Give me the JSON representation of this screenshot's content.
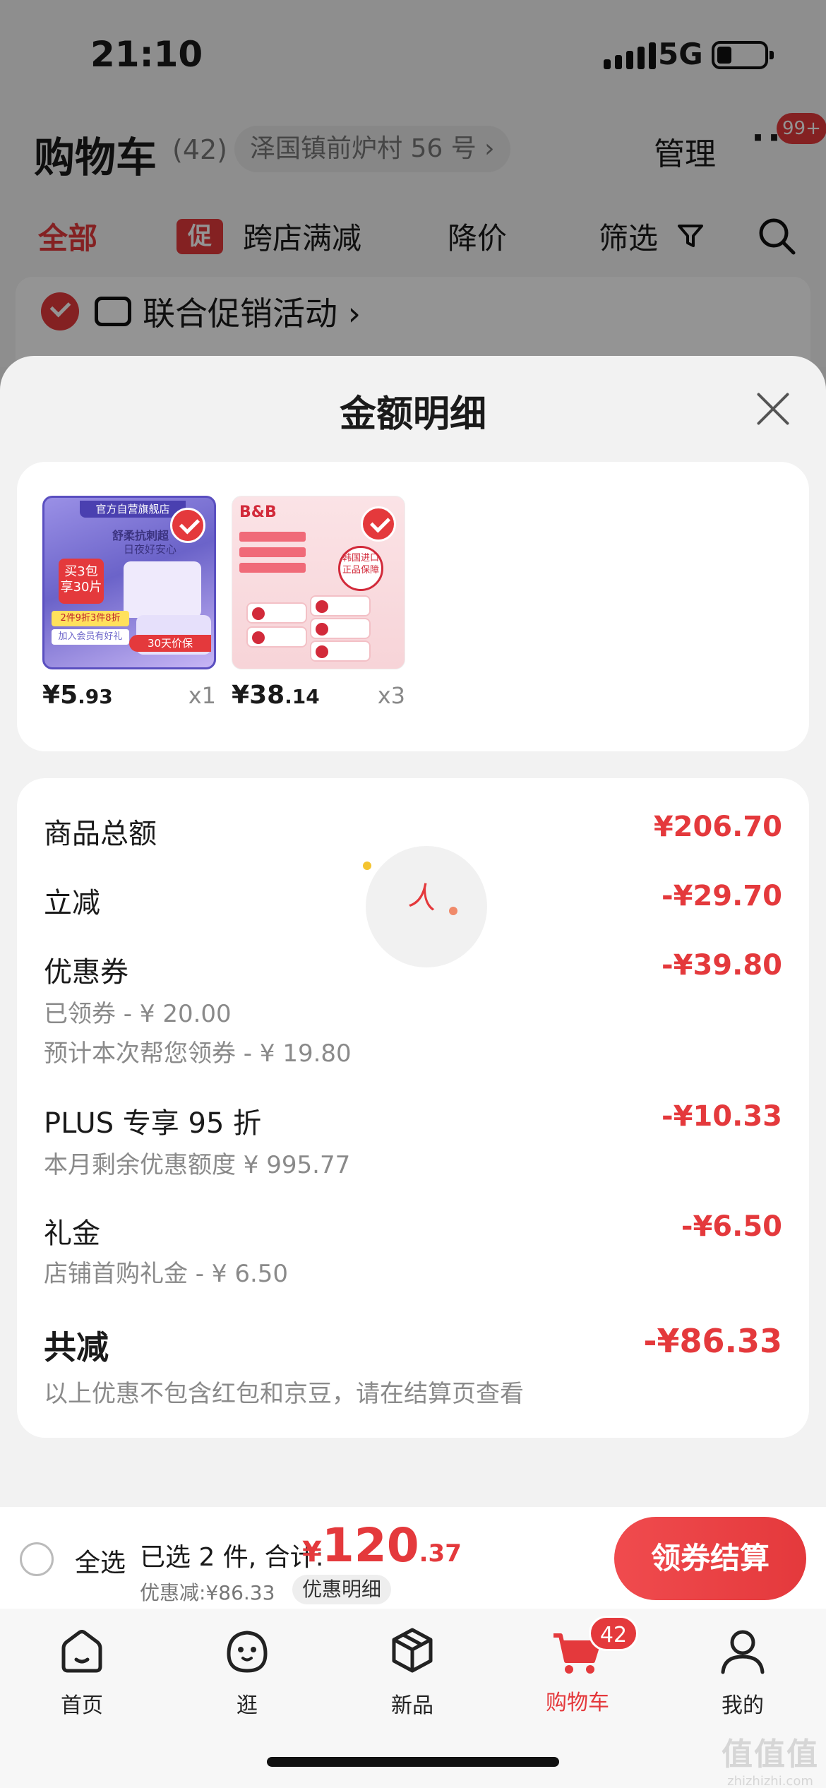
{
  "status_bar": {
    "time": "21:10",
    "network": "5G"
  },
  "cart_header": {
    "title": "购物车",
    "count": "(42)",
    "address": "泽国镇前炉村 56 号 ›",
    "manage": "管理",
    "more": "···",
    "more_badge": "99+"
  },
  "filters": {
    "all": "全部",
    "promo_tag": "促",
    "promo": "跨店满减",
    "price_drop": "降价",
    "filter": "筛选"
  },
  "promo_row": {
    "label": "联合促销活动 ›"
  },
  "sheet": {
    "title": "金额明细",
    "products": [
      {
        "price_symbol": "¥",
        "price_int": "5",
        "price_dec": ".93",
        "qty": "x1",
        "image_text": {
          "store": "官方自营旗舰店",
          "line1": "舒柔抗刺超",
          "line2": "日夜好安心",
          "badge": "买3包 享30片",
          "stripe": "2件9折3件8折",
          "stripe2": "加入会员有好礼",
          "bottom": "30天价保"
        }
      },
      {
        "price_symbol": "¥",
        "price_int": "38",
        "price_dec": ".14",
        "qty": "x3",
        "image_text": {
          "logo": "B&B",
          "seal": "韩国进口 正品保障"
        }
      }
    ],
    "breakdown": {
      "goods_total": {
        "label": "商品总额",
        "value": "¥206.70"
      },
      "instant_off": {
        "label": "立减",
        "value": "-¥29.70"
      },
      "coupon": {
        "label": "优惠券",
        "value": "-¥39.80",
        "sub1": "已领券 - ¥ 20.00",
        "sub2": "预计本次帮您领券 - ¥ 19.80"
      },
      "plus": {
        "label": "PLUS 专享 95 折",
        "value": "-¥10.33",
        "sub": "本月剩余优惠额度 ¥ 995.77"
      },
      "gift": {
        "label": "礼金",
        "value": "-¥6.50",
        "sub": "店铺首购礼金 - ¥ 6.50"
      },
      "total": {
        "label": "共减",
        "value": "-¥86.33",
        "sub": "以上优惠不包含红包和京豆，请在结算页查看"
      }
    }
  },
  "checkout": {
    "select_all": "全选",
    "selected": "已选 2 件, 合计:",
    "price_symbol": "¥",
    "price_int": "120",
    "price_dec": ".37",
    "discount": "优惠减:¥86.33",
    "detail_pill": "优惠明细",
    "button": "领券结算"
  },
  "tabbar": {
    "items": [
      {
        "label": "首页",
        "icon": "home-icon"
      },
      {
        "label": "逛",
        "icon": "browse-face-icon"
      },
      {
        "label": "新品",
        "icon": "new-box-icon"
      },
      {
        "label": "购物车",
        "icon": "cart-icon",
        "badge": "42"
      },
      {
        "label": "我的",
        "icon": "profile-icon"
      }
    ]
  },
  "watermark": {
    "big": "值值值",
    "small": "zhizhizhi.com"
  },
  "colors": {
    "accent": "#e4393c",
    "background": "#f2f2f2"
  }
}
